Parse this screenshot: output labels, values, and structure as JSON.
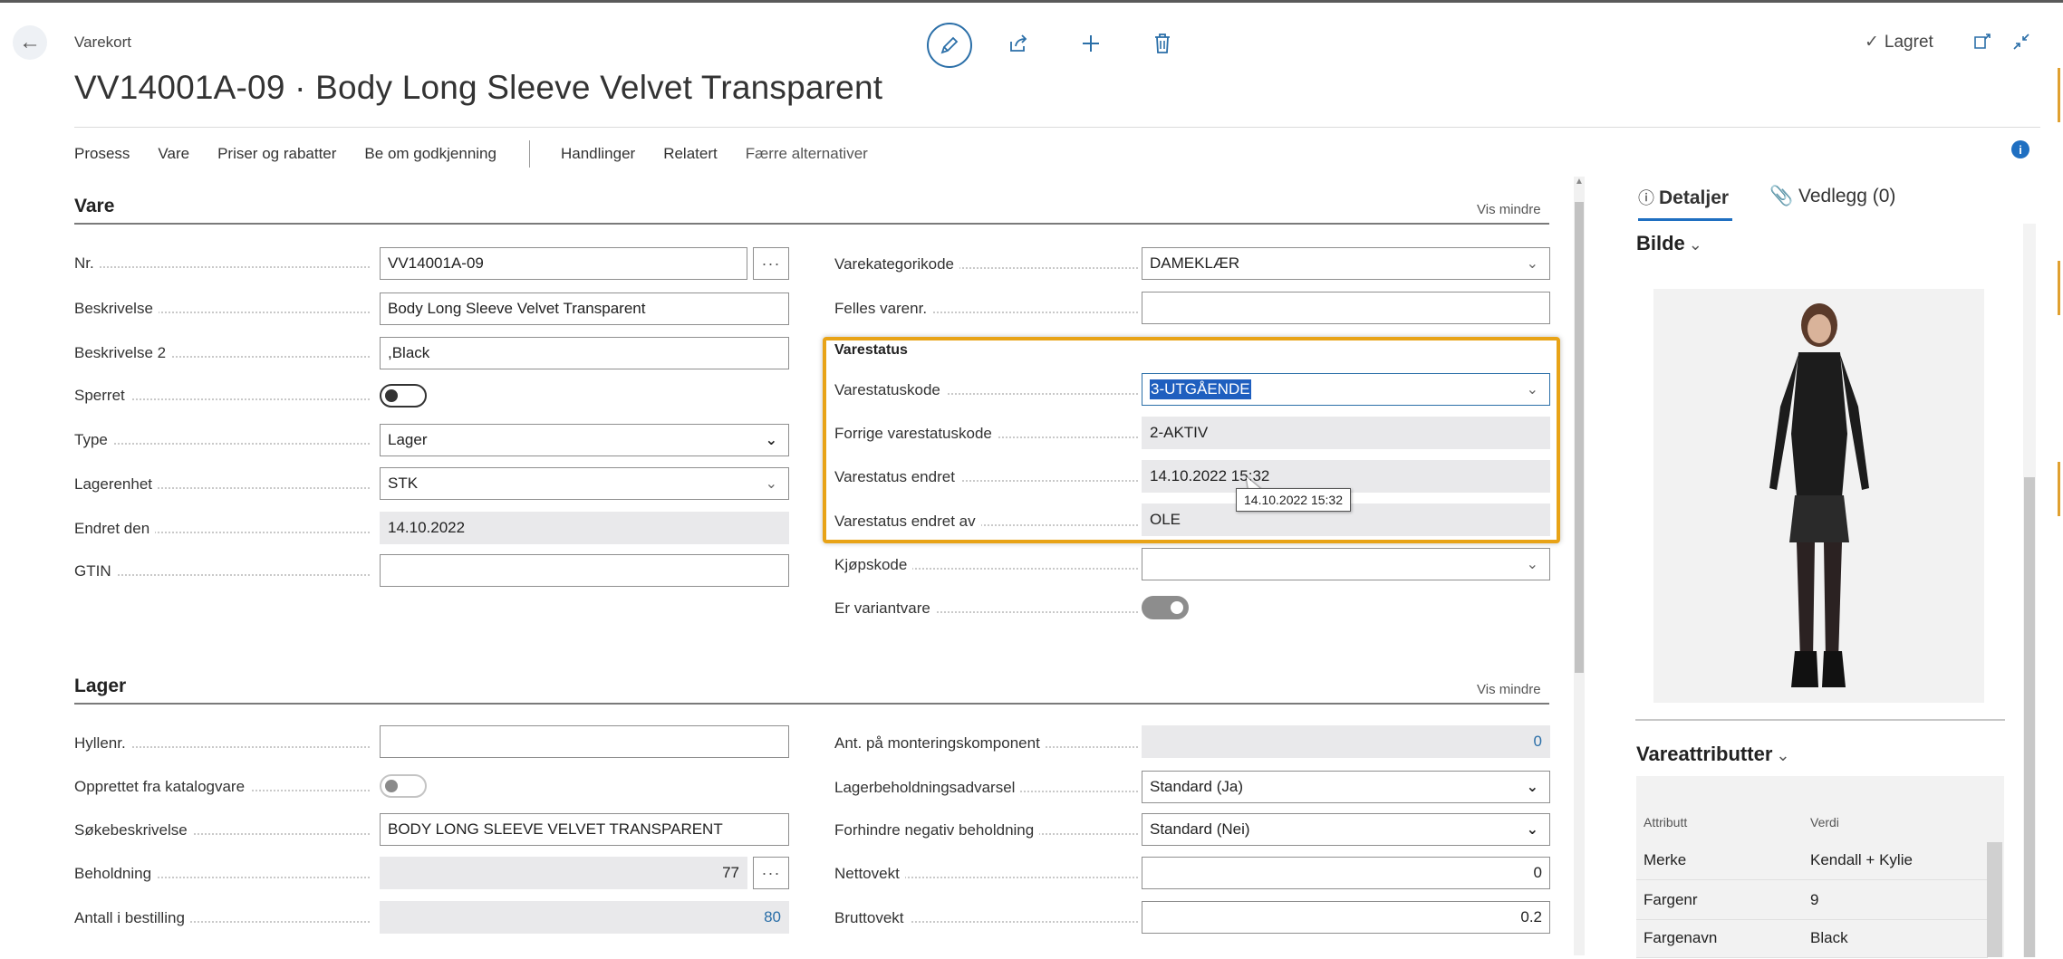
{
  "header": {
    "kicker": "Varekort",
    "title": "VV14001A-09 · Body Long Sleeve Velvet Transparent",
    "saved_label": "Lagret"
  },
  "actions": [
    {
      "label": "Prosess"
    },
    {
      "label": "Vare"
    },
    {
      "label": "Priser og rabatter"
    },
    {
      "label": "Be om godkjenning"
    },
    {
      "label": "Handlinger"
    },
    {
      "label": "Relatert"
    },
    {
      "label": "Færre alternativer"
    }
  ],
  "vare": {
    "title": "Vare",
    "toggle_label": "Vis mindre",
    "nr_label": "Nr.",
    "nr_value": "VV14001A-09",
    "beskrivelse_label": "Beskrivelse",
    "beskrivelse_value": "Body Long Sleeve Velvet Transparent",
    "beskrivelse2_label": "Beskrivelse 2",
    "beskrivelse2_value": ",Black",
    "sperret_label": "Sperret",
    "type_label": "Type",
    "type_value": "Lager",
    "lagerenhet_label": "Lagerenhet",
    "lagerenhet_value": "STK",
    "endret_label": "Endret den",
    "endret_value": "14.10.2022",
    "gtin_label": "GTIN",
    "gtin_value": "",
    "varekategori_label": "Varekategorikode",
    "varekategori_value": "DAMEKLÆR",
    "felles_label": "Felles varenr.",
    "felles_value": "",
    "varestatus_group": "Varestatus",
    "statuskode_label": "Varestatuskode",
    "statuskode_value": "3-UTGÅENDE",
    "forrige_label": "Forrige varestatuskode",
    "forrige_value": "2-AKTIV",
    "status_endret_label": "Varestatus endret",
    "status_endret_value": "14.10.2022 15:32",
    "status_endret_av_label": "Varestatus endret av",
    "status_endret_av_value": "OLE",
    "tooltip": "14.10.2022 15:32",
    "kjopskode_label": "Kjøpskode",
    "kjopskode_value": "",
    "variant_label": "Er variantvare"
  },
  "lager": {
    "title": "Lager",
    "toggle_label": "Vis mindre",
    "hylle_label": "Hyllenr.",
    "hylle_value": "",
    "katalog_label": "Opprettet fra katalogvare",
    "sok_label": "Søkebeskrivelse",
    "sok_value": "BODY LONG SLEEVE VELVET TRANSPARENT",
    "beholdning_label": "Beholdning",
    "beholdning_value": "77",
    "bestilling_label": "Antall i bestilling",
    "bestilling_value": "80",
    "montering_label": "Ant. på monteringskomponent",
    "montering_value": "0",
    "advarsel_label": "Lagerbeholdningsadvarsel",
    "advarsel_value": "Standard (Ja)",
    "negativ_label": "Forhindre negativ beholdning",
    "negativ_value": "Standard (Nei)",
    "netto_label": "Nettovekt",
    "netto_value": "0",
    "brutto_label": "Bruttovekt",
    "brutto_value": "0.2"
  },
  "factbox": {
    "tab_details": "Detaljer",
    "tab_attachments": "Vedlegg (0)",
    "bilde_title": "Bilde",
    "attr_title": "Vareattributter",
    "attr_col_name": "Attributt",
    "attr_col_value": "Verdi",
    "attributes": [
      {
        "name": "Merke",
        "value": "Kendall + Kylie"
      },
      {
        "name": "Fargenr",
        "value": "9"
      },
      {
        "name": "Fargenavn",
        "value": "Black"
      }
    ]
  },
  "colors": {
    "accent": "#2b6fa8",
    "highlight": "#e8a317",
    "selection": "#1f5fbf"
  }
}
